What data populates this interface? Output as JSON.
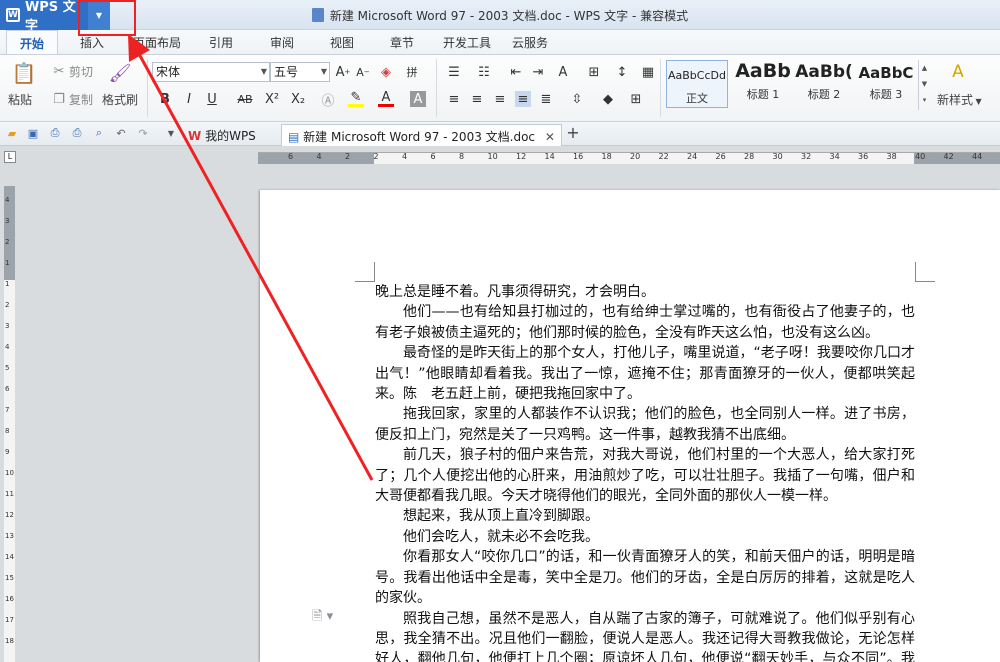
{
  "app": {
    "name": "WPS 文字",
    "window_title": "新建 Microsoft Word 97 - 2003 文档.doc - WPS 文字 - 兼容模式"
  },
  "menu_tabs": [
    "开始",
    "插入",
    "页面布局",
    "引用",
    "审阅",
    "视图",
    "章节",
    "开发工具",
    "云服务"
  ],
  "ribbon": {
    "paste": "粘贴",
    "cut": "剪切",
    "copy": "复制",
    "format_painter": "格式刷",
    "font_name": "宋体",
    "font_size": "五号",
    "styles": [
      {
        "sample": "AaBbCcDd",
        "name": "正文"
      },
      {
        "sample": "AaBb",
        "name": "标题 1"
      },
      {
        "sample": "AaBb(",
        "name": "标题 2"
      },
      {
        "sample": "AaBbC",
        "name": "标题 3"
      }
    ],
    "new_style": "新样式"
  },
  "quickbar": {
    "tabs": [
      {
        "label": "我的WPS"
      },
      {
        "label": "新建 Microsoft Word 97 - 2003 文档.doc"
      }
    ]
  },
  "ruler": {
    "h_numbers": [
      "6",
      "4",
      "2",
      "2",
      "4",
      "6",
      "8",
      "10",
      "12",
      "14",
      "16",
      "18",
      "20",
      "22",
      "24",
      "26",
      "28",
      "30",
      "32",
      "34",
      "36",
      "38",
      "40",
      "42",
      "44"
    ],
    "v_numbers": [
      "4",
      "3",
      "2",
      "1",
      "1",
      "2",
      "3",
      "4",
      "5",
      "6",
      "7",
      "8",
      "9",
      "10",
      "11",
      "12",
      "13",
      "14",
      "15",
      "16",
      "17",
      "18"
    ]
  },
  "document": {
    "paragraphs": [
      {
        "text": "晚上总是睡不着。凡事须得研究，才会明白。",
        "indent": false
      },
      {
        "text": "他们——也有给知县打枷过的，也有给绅士掌过嘴的，也有衙役占了他妻子的，也有老子娘被债主逼死的；他们那时候的脸色，全没有昨天这么怕，也没有这么凶。",
        "indent": true
      },
      {
        "text": "最奇怪的是昨天街上的那个女人，打他儿子，嘴里说道，“老子呀！我要咬你几口才出气！”他眼睛却看着我。我出了一惊，遮掩不住；那青面獠牙的一伙人，便都哄笑起来。陈　老五赶上前，硬把我拖回家中了。",
        "indent": true
      },
      {
        "text": "拖我回家，家里的人都装作不认识我；他们的脸色，也全同别人一样。进了书房，便反扣上门，宛然是关了一只鸡鸭。这一件事，越教我猜不出底细。",
        "indent": true
      },
      {
        "text": "前几天，狼子村的佃户来告荒，对我大哥说，他们村里的一个大恶人，给大家打死了；几个人便挖出他的心肝来，用油煎炒了吃，可以壮壮胆子。我插了一句嘴，佃户和大哥便都看我几眼。今天才晓得他们的眼光，全同外面的那伙人一模一样。",
        "indent": true
      },
      {
        "text": "想起来，我从顶上直冷到脚跟。",
        "indent": true
      },
      {
        "text": "他们会吃人，就未必不会吃我。",
        "indent": true
      },
      {
        "text": "你看那女人“咬你几口”的话，和一伙青面獠牙人的笑，和前天佃户的话，明明是暗号。我看出他话中全是毒，笑中全是刀。他们的牙齿，全是白厉厉的排着，这就是吃人的家伙。",
        "indent": true
      },
      {
        "text": "照我自己想，虽然不是恶人，自从踹了古家的簿子，可就难说了。他们似乎别有心思，我全猜不出。况且他们一翻脸，便说人是恶人。我还记得大哥教我做论，无论怎样好人，翻他几句，他便打上几个圈；原谅坏人几句，他便说“翻天妙手，与众不同”。我那里猜得到他们的心思，究竟怎样；况且是要吃的时候。",
        "indent": true
      }
    ]
  }
}
